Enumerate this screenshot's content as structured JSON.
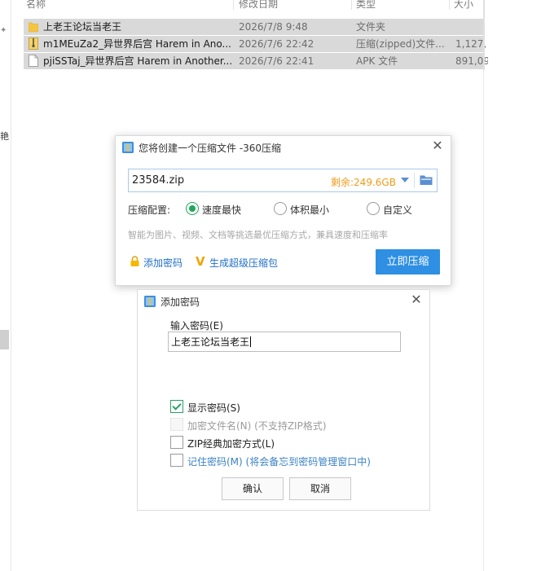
{
  "explorer": {
    "left_char": "艳",
    "columns": {
      "name": "名称",
      "date": "修改日期",
      "type": "类型",
      "size": "大小"
    },
    "rows": [
      {
        "name": "上老王论坛当老王",
        "date": "2026/7/8 9:48",
        "type": "文件夹",
        "size": "",
        "icon": "folder-icon"
      },
      {
        "name": "m1MEuZa2_异世界后宫 Harem in Ano...",
        "date": "2026/7/6 22:42",
        "type": "压缩(zipped)文件...",
        "size": "1,127,",
        "icon": "zip-file-icon"
      },
      {
        "name": "pjiSSTaj_异世界后宫 Harem in Another...",
        "date": "2026/7/6 22:41",
        "type": "APK 文件",
        "size": "891,09",
        "icon": "file-icon"
      }
    ]
  },
  "compress_dialog": {
    "title": "您将创建一个压缩文件 -360压缩",
    "path_value": "23584.zip",
    "free_space": "剩余:249.6GB",
    "config_label": "压缩配置:",
    "options": [
      {
        "label": "速度最快",
        "selected": true
      },
      {
        "label": "体积最小",
        "selected": false
      },
      {
        "label": "自定义",
        "selected": false
      }
    ],
    "description": "智能为图片、视频、文档等挑选最优压缩方式，兼具速度和压缩率",
    "add_password_link": "添加密码",
    "super_pack_link": "生成超级压缩包",
    "compress_button": "立即压缩",
    "accent_color": "#2e8fe3",
    "warning_color": "#f19b1a"
  },
  "password_dialog": {
    "title": "添加密码",
    "input_label": "输入密码(E)",
    "input_value": "上老王论坛当老王",
    "checkboxes": [
      {
        "label": "显示密码(S)",
        "checked": true,
        "disabled": false
      },
      {
        "label": "加密文件名(N) (不支持ZIP格式)",
        "checked": false,
        "disabled": true
      },
      {
        "label": "ZIP经典加密方式(L)",
        "checked": false,
        "disabled": false
      },
      {
        "label": "记住密码(M) (将会备忘到密码管理窗口中)",
        "checked": false,
        "disabled": false
      }
    ],
    "ok_button": "确认",
    "cancel_button": "取消"
  }
}
